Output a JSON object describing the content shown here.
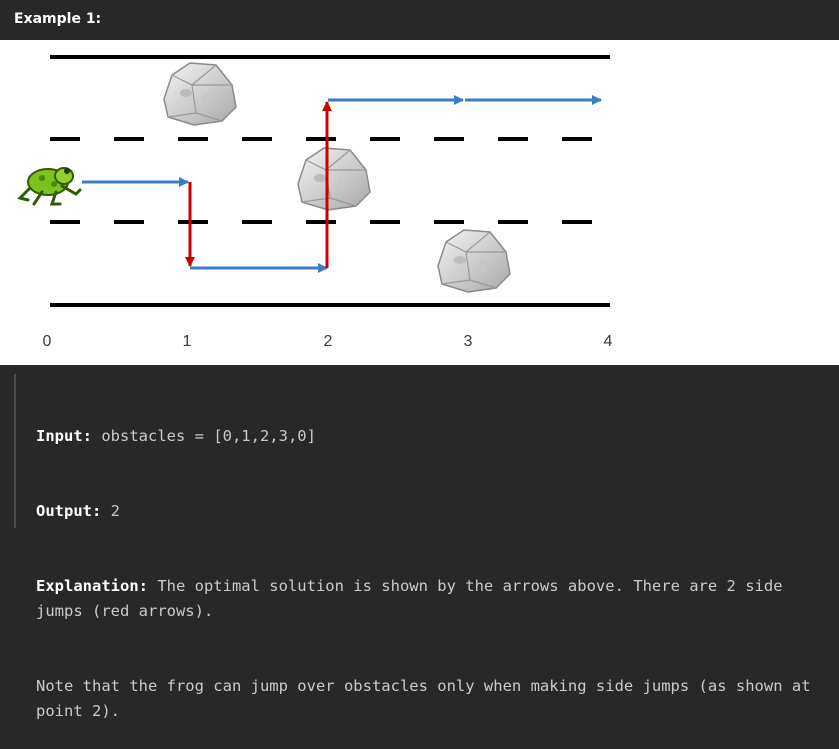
{
  "heading": "Example 1:",
  "diagram": {
    "tick_labels": [
      "0",
      "1",
      "2",
      "3",
      "4"
    ],
    "colors": {
      "lane_line": "#000000",
      "forward_arrow": "#3b7dc4",
      "side_jump_arrow": "#cc0000",
      "tick_label": "#3a3a3a",
      "rock": "#d8d8d8",
      "frog": "#7dc11e"
    },
    "icons": {
      "frog": "frog-icon",
      "rock": "rock-icon"
    }
  },
  "example": {
    "input_label": "Input:",
    "input_value": " obstacles = [0,1,2,3,0]",
    "output_label": "Output:",
    "output_value": " 2",
    "explanation_label": "Explanation:",
    "explanation_text": " The optimal solution is shown by the arrows above. There are 2 side jumps (red arrows).",
    "note_text": "Note that the frog can jump over obstacles only when making side jumps (as shown at point 2)."
  }
}
